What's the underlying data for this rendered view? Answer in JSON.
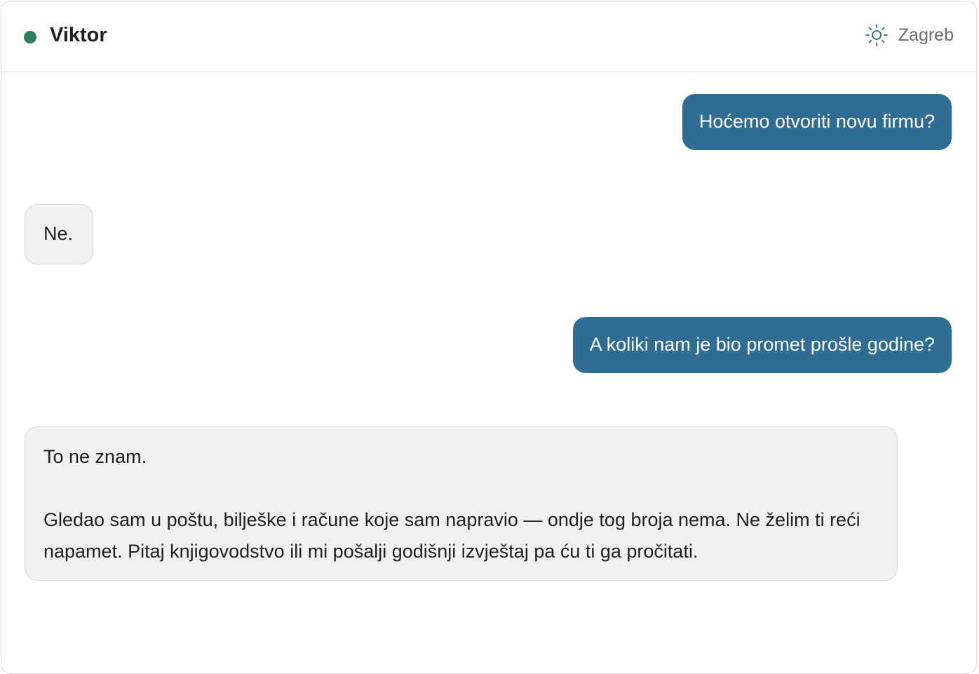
{
  "header": {
    "contact_name": "Viktor",
    "status_color": "#2e7d5b",
    "location_icon": "sun-icon",
    "location": "Zagreb"
  },
  "messages": [
    {
      "from": "user",
      "text": "Hoćemo otvoriti novu firmu?"
    },
    {
      "from": "bot",
      "paragraphs": [
        "Ne."
      ]
    },
    {
      "from": "user",
      "text": "A koliki nam je bio promet prošle godine?"
    },
    {
      "from": "bot",
      "paragraphs": [
        "To ne znam.",
        "Gledao sam u poštu, bilješke i račune koje sam napravio — ondje tog broja nema. Ne želim ti reći napamet. Pitaj knjigovodstvo ili mi pošalji godišnji izvještaj pa ću ti ga pročitati."
      ]
    }
  ],
  "colors": {
    "user_bubble": "#2f6d94",
    "bot_bubble": "#f1f1ef"
  }
}
